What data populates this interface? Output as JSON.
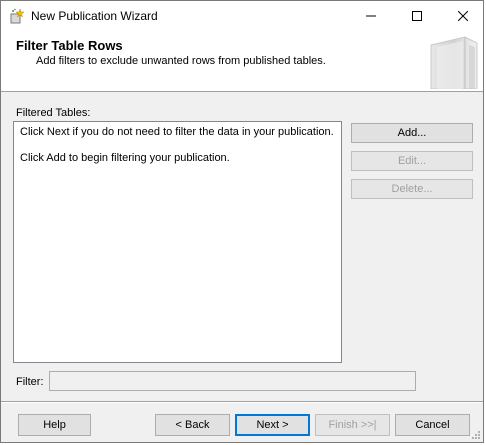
{
  "window": {
    "title": "New Publication Wizard",
    "icons": {
      "app": "wizard-app-icon",
      "minimize": "minimize-icon",
      "maximize": "maximize-icon",
      "close": "close-icon"
    }
  },
  "header": {
    "title": "Filter Table Rows",
    "subtitle": "Add filters to exclude unwanted rows from published tables.",
    "graphic_icon": "book-graphic"
  },
  "filtered_tables": {
    "label": "Filtered Tables:",
    "lines": [
      "Click Next if you do not need to filter the data in your publication.",
      "Click Add to begin filtering your publication."
    ]
  },
  "side_buttons": {
    "add": "Add...",
    "edit": "Edit...",
    "delete": "Delete..."
  },
  "filter": {
    "label": "Filter:",
    "value": ""
  },
  "footer": {
    "help": "Help",
    "back": "< Back",
    "next": "Next >",
    "finish": "Finish >>|",
    "cancel": "Cancel"
  },
  "colors": {
    "accent": "#0078d7",
    "dialog_bg": "#f0f0f0",
    "disabled_text": "#a0a0a0"
  }
}
